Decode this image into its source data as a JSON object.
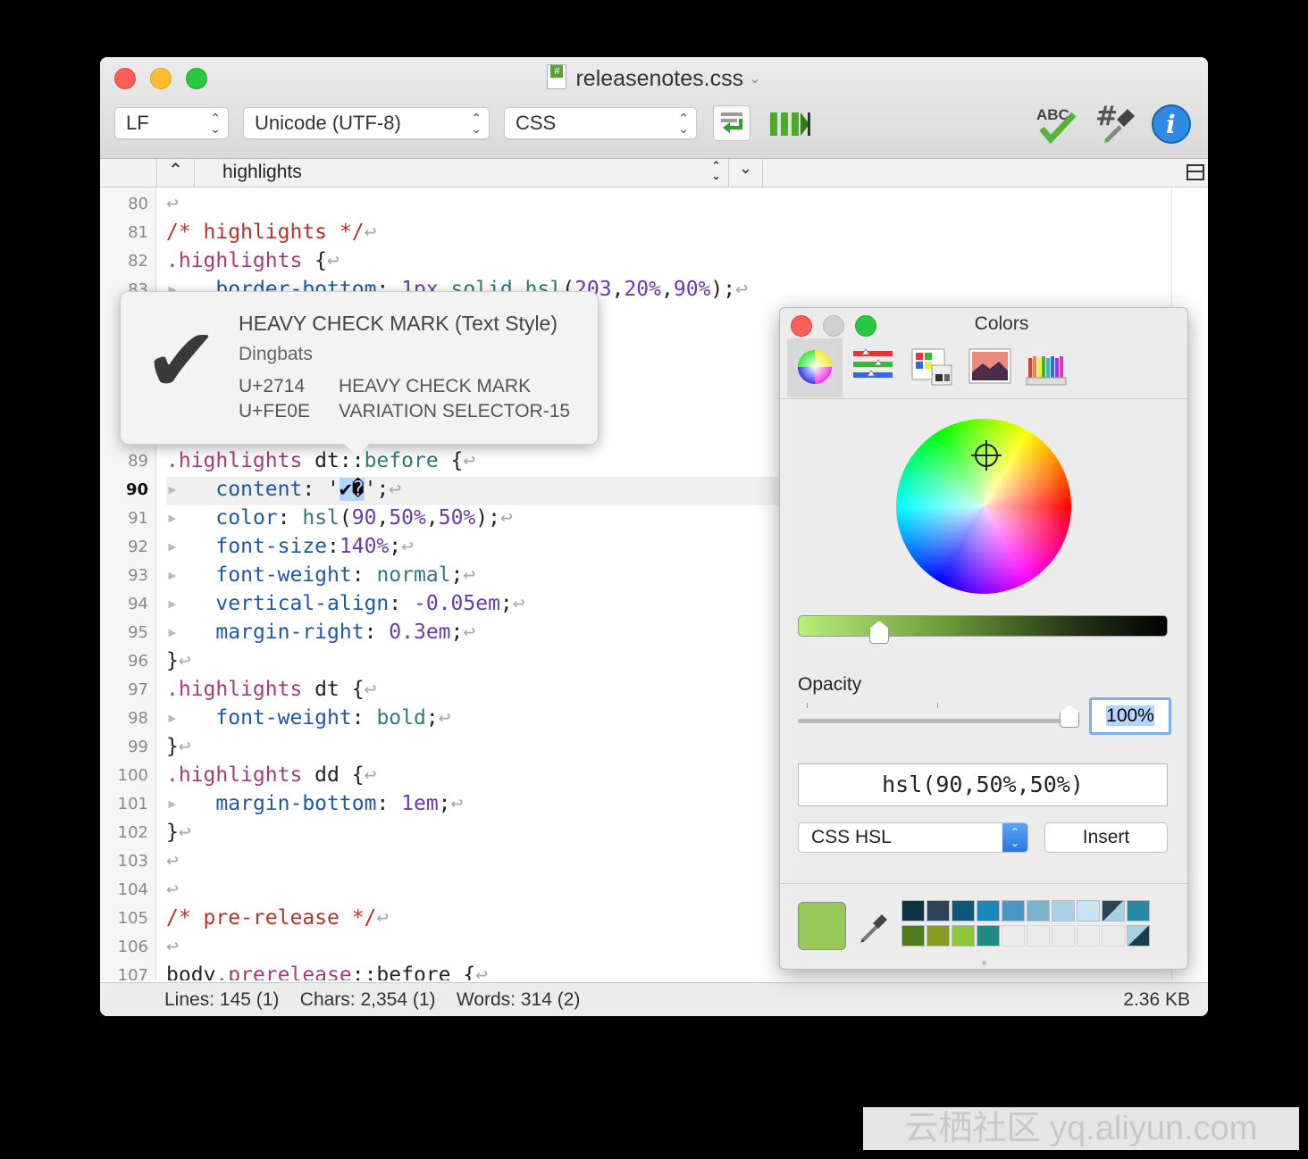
{
  "window": {
    "title": "releasenotes.css",
    "line_ending": "LF",
    "encoding": "Unicode (UTF-8)",
    "language": "CSS"
  },
  "navbar": {
    "symbol": "highlights"
  },
  "lines": [
    {
      "num": "80",
      "tokens": []
    },
    {
      "num": "81",
      "tokens": [
        [
          "c-comment",
          "/* highlights */"
        ]
      ]
    },
    {
      "num": "82",
      "tokens": [
        [
          "c-sel",
          ".highlights"
        ],
        [
          "c-pl",
          " {"
        ]
      ]
    },
    {
      "num": "83",
      "tokens": [
        [
          "tabmark",
          "▸"
        ],
        [
          "c-pl",
          "   "
        ],
        [
          "c-prop",
          "border-bottom"
        ],
        [
          "c-pl",
          ": "
        ],
        [
          "c-val",
          "1px"
        ],
        [
          "c-pl",
          " "
        ],
        [
          "c-kw",
          "solid"
        ],
        [
          "c-pl",
          " "
        ],
        [
          "c-kw",
          "hsl"
        ],
        [
          "c-pl",
          "("
        ],
        [
          "c-val",
          "203"
        ],
        [
          "c-pl",
          ","
        ],
        [
          "c-val",
          "20%"
        ],
        [
          "c-pl",
          ","
        ],
        [
          "c-val",
          "90%"
        ],
        [
          "c-pl",
          ");"
        ]
      ]
    },
    {
      "num": "84",
      "tokens": []
    },
    {
      "num": "85",
      "tokens": []
    },
    {
      "num": "86",
      "tokens": []
    },
    {
      "num": "87",
      "tokens": []
    },
    {
      "num": "88",
      "tokens": []
    },
    {
      "num": "89",
      "tokens": [
        [
          "c-sel",
          ".highlights"
        ],
        [
          "c-pl",
          " dt::"
        ],
        [
          "c-kw",
          "before"
        ],
        [
          "c-pl",
          " {"
        ]
      ]
    },
    {
      "num": "90",
      "tokens": [
        [
          "tabmark",
          "▸"
        ],
        [
          "c-pl",
          "   "
        ],
        [
          "c-prop",
          "content"
        ],
        [
          "c-pl",
          ": '"
        ],
        [
          "sel-hl",
          "✔�"
        ],
        [
          "c-pl",
          "';"
        ]
      ],
      "current": true
    },
    {
      "num": "91",
      "tokens": [
        [
          "tabmark",
          "▸"
        ],
        [
          "c-pl",
          "   "
        ],
        [
          "c-prop",
          "color"
        ],
        [
          "c-pl",
          ": "
        ],
        [
          "c-kw",
          "hsl"
        ],
        [
          "c-pl",
          "("
        ],
        [
          "c-val",
          "90"
        ],
        [
          "c-pl",
          ","
        ],
        [
          "c-val",
          "50%"
        ],
        [
          "c-pl",
          ","
        ],
        [
          "c-val",
          "50%"
        ],
        [
          "c-pl",
          ");"
        ]
      ]
    },
    {
      "num": "92",
      "tokens": [
        [
          "tabmark",
          "▸"
        ],
        [
          "c-pl",
          "   "
        ],
        [
          "c-prop",
          "font-size"
        ],
        [
          "c-pl",
          ":"
        ],
        [
          "c-val",
          "140%"
        ],
        [
          "c-pl",
          ";"
        ]
      ]
    },
    {
      "num": "93",
      "tokens": [
        [
          "tabmark",
          "▸"
        ],
        [
          "c-pl",
          "   "
        ],
        [
          "c-prop",
          "font-weight"
        ],
        [
          "c-pl",
          ": "
        ],
        [
          "c-kw",
          "normal"
        ],
        [
          "c-pl",
          ";"
        ]
      ]
    },
    {
      "num": "94",
      "tokens": [
        [
          "tabmark",
          "▸"
        ],
        [
          "c-pl",
          "   "
        ],
        [
          "c-prop",
          "vertical-align"
        ],
        [
          "c-pl",
          ": "
        ],
        [
          "c-val",
          "-0.05em"
        ],
        [
          "c-pl",
          ";"
        ]
      ]
    },
    {
      "num": "95",
      "tokens": [
        [
          "tabmark",
          "▸"
        ],
        [
          "c-pl",
          "   "
        ],
        [
          "c-prop",
          "margin-right"
        ],
        [
          "c-pl",
          ": "
        ],
        [
          "c-val",
          "0.3em"
        ],
        [
          "c-pl",
          ";"
        ]
      ]
    },
    {
      "num": "96",
      "tokens": [
        [
          "c-pl",
          "}"
        ]
      ]
    },
    {
      "num": "97",
      "tokens": [
        [
          "c-sel",
          ".highlights"
        ],
        [
          "c-pl",
          " dt {"
        ]
      ]
    },
    {
      "num": "98",
      "tokens": [
        [
          "tabmark",
          "▸"
        ],
        [
          "c-pl",
          "   "
        ],
        [
          "c-prop",
          "font-weight"
        ],
        [
          "c-pl",
          ": "
        ],
        [
          "c-kw",
          "bold"
        ],
        [
          "c-pl",
          ";"
        ]
      ]
    },
    {
      "num": "99",
      "tokens": [
        [
          "c-pl",
          "}"
        ]
      ]
    },
    {
      "num": "100",
      "tokens": [
        [
          "c-sel",
          ".highlights"
        ],
        [
          "c-pl",
          " dd {"
        ]
      ]
    },
    {
      "num": "101",
      "tokens": [
        [
          "tabmark",
          "▸"
        ],
        [
          "c-pl",
          "   "
        ],
        [
          "c-prop",
          "margin-bottom"
        ],
        [
          "c-pl",
          ": "
        ],
        [
          "c-val",
          "1em"
        ],
        [
          "c-pl",
          ";"
        ]
      ]
    },
    {
      "num": "102",
      "tokens": [
        [
          "c-pl",
          "}"
        ]
      ]
    },
    {
      "num": "103",
      "tokens": []
    },
    {
      "num": "104",
      "tokens": []
    },
    {
      "num": "105",
      "tokens": [
        [
          "c-comment",
          "/* pre-release */"
        ]
      ]
    },
    {
      "num": "106",
      "tokens": []
    },
    {
      "num": "107",
      "tokens": [
        [
          "c-pl",
          "body"
        ],
        [
          "c-sel",
          ".prerelease"
        ],
        [
          "c-pl",
          "::before {"
        ]
      ]
    }
  ],
  "popover": {
    "glyph": "✔",
    "title": "HEAVY CHECK MARK (Text Style)",
    "block": "Dingbats",
    "codepoints": [
      {
        "cp": "U+2714",
        "name": "HEAVY CHECK MARK"
      },
      {
        "cp": "U+FE0E",
        "name": "VARIATION SELECTOR-15"
      }
    ]
  },
  "status": {
    "lines_label": "Lines:",
    "lines_value": "145 (1)",
    "chars_label": "Chars:",
    "chars_value": "2,354 (1)",
    "words_label": "Words:",
    "words_value": "314 (2)",
    "size": "2.36 KB"
  },
  "colors_panel": {
    "title": "Colors",
    "modes": [
      "color-wheel-icon",
      "sliders-icon",
      "palettes-icon",
      "image-palette-icon",
      "pencils-icon"
    ],
    "opacity_label": "Opacity",
    "opacity_value": "100%",
    "opacity_level": 1.0,
    "brightness_level": 0.22,
    "color_string": "hsl(90,50%,50%)",
    "format": "CSS HSL",
    "insert_label": "Insert",
    "current_color": "#97c95a",
    "swatches": [
      [
        "#0e3344",
        "#2c4457",
        "#0c5876",
        "#1b88c0",
        "#4a96c5",
        "#79b3cc",
        "#a8d1e6",
        "#c7e4f1",
        "split:#2c4457/#a8d1e6",
        "#2a8aa3"
      ],
      [
        "#4d7a1a",
        "#869a1f",
        "#8cc63a",
        "#1f8a86",
        "",
        "",
        "",
        "",
        "",
        "split:#a8d1e6/#1b3c4a"
      ]
    ]
  },
  "watermark": "云栖社区 yq.aliyun.com"
}
